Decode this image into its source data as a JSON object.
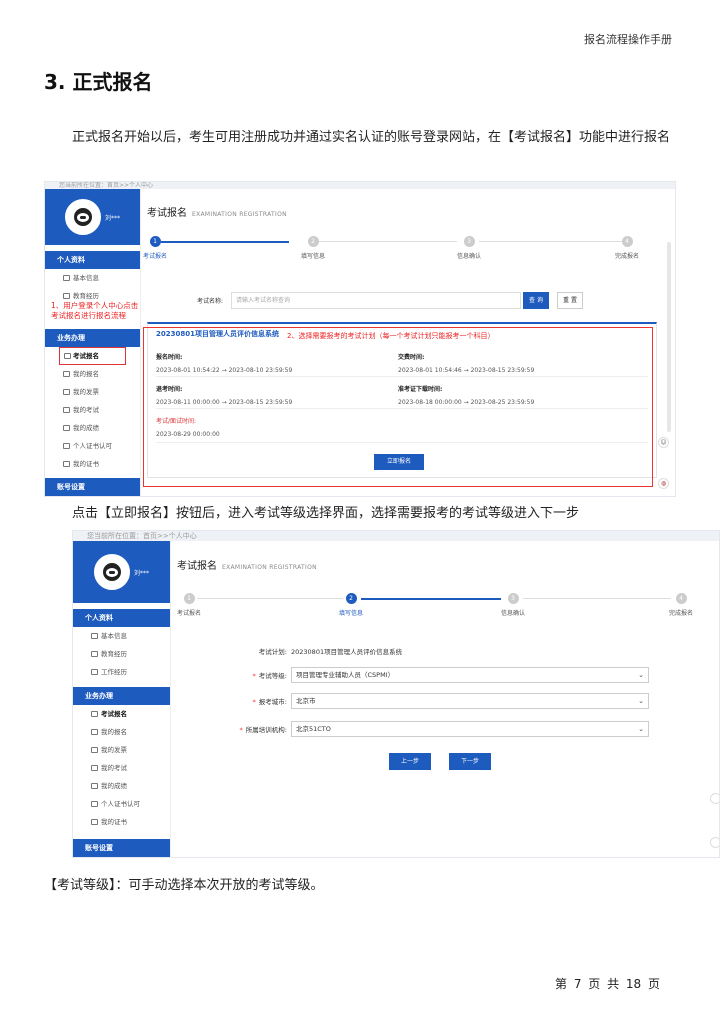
{
  "doc": {
    "header": "报名流程操作手册",
    "section_title": "3. 正式报名",
    "para1": "正式报名开始以后，考生可用注册成功并通过实名认证的账号登录网站，在【考试报名】功能中进行报名",
    "para2": "点击【立即报名】按钮后，进入考试等级选择界面，选择需要报考的考试等级进入下一步",
    "para3": "【考试等级】：可手动选择本次开放的考试等级。",
    "footer": "第 7 页 共 18 页"
  },
  "app": {
    "breadcrumb": "您当前所在位置：首页>>个人中心",
    "user_name": "刘***",
    "personal_head": "个人资料",
    "personal_items": [
      "基本信息",
      "教育经历",
      "工作经历"
    ],
    "business_head": "业务办理",
    "business_items": [
      "考试报名",
      "我的报名",
      "我的发票",
      "我的考试",
      "我的成绩",
      "个人证书认可",
      "我的证书"
    ],
    "account_head": "账号设置",
    "panel_title": "考试报名",
    "panel_sub": "EXAMINATION REGISTRATION",
    "steps": [
      {
        "num": "1",
        "label": "考试报名"
      },
      {
        "num": "2",
        "label": "填写信息"
      },
      {
        "num": "3",
        "label": "信息确认"
      },
      {
        "num": "4",
        "label": "完成报名"
      }
    ]
  },
  "shot1": {
    "search_label": "考试名称:",
    "search_placeholder": "请输入考试名称查询",
    "query_btn": "查 询",
    "reset_btn": "重 置",
    "plan_name": "20230801项目管理人员评价信息系统",
    "fields": {
      "signup_label": "报名时间:",
      "signup_value": "2023-08-01 10:54:22  →  2023-08-10 23:59:59",
      "pay_label": "交费时间:",
      "pay_value": "2023-08-01 10:54:46  →  2023-08-15 23:59:59",
      "refund_label": "退考时间:",
      "refund_value": "2023-08-11 00:00:00  →  2023-08-15 23:59:59",
      "ticket_label": "准考证下载时间:",
      "ticket_value": "2023-08-18 00:00:00  →  2023-08-25 23:59:59",
      "exam_label": "考试/面试时间:",
      "exam_value": "2023-08-29 00:00:00"
    },
    "apply_btn": "立即报名",
    "note_left_1": "1、用户登录个人中心点击",
    "note_left_2": "考试报名进行报名流程",
    "note_plan": "2、选择需要报考的考试计划（每一个考试计划只能报考一个科目）"
  },
  "shot2": {
    "plan_label": "考试计划:",
    "plan_value": "20230801项目管理人员评价信息系统",
    "level_label": "考试等级:",
    "level_value": "项目管理专业辅助人员（CSPMI）",
    "city_label": "报考城市:",
    "city_value": "北京市",
    "org_label": "所属培训机构:",
    "org_value": "北京51CTO",
    "prev_btn": "上一步",
    "next_btn": "下一步"
  },
  "colors": {
    "brand": "#1e5bbf",
    "annotation": "#e33333"
  },
  "icons": [
    "avatar-icon",
    "user-icon",
    "edit-icon",
    "file-icon",
    "chevron-down-icon",
    "smile-icon"
  ]
}
